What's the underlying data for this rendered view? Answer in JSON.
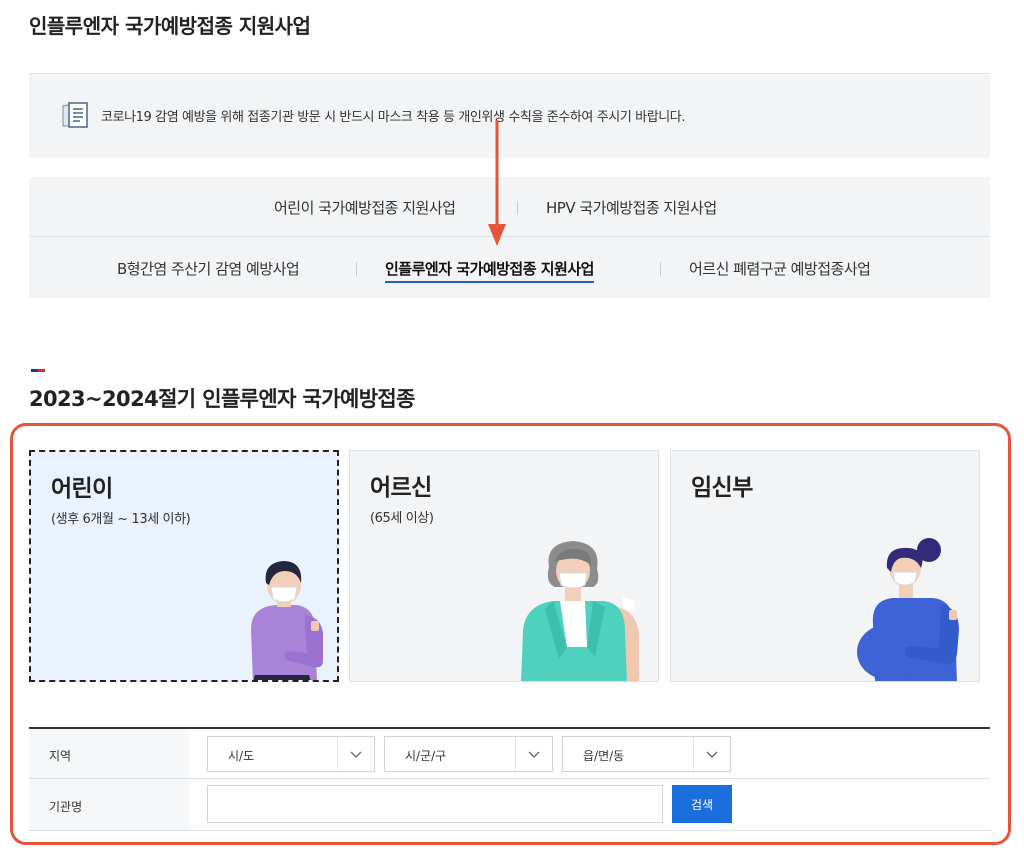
{
  "page_title": "인플루엔자 국가예방접종 지원사업",
  "notice": {
    "text": "코로나19 감염 예방을 위해 접종기관 방문 시 반드시 마스크 착용 등 개인위생 수칙을 준수하여 주시기 바랍니다."
  },
  "tabs": {
    "row1": [
      {
        "label": "어린이 국가예방접종 지원사업"
      },
      {
        "label": "HPV 국가예방접종 지원사업"
      }
    ],
    "row2": [
      {
        "label": "B형간염 주산기 감염 예방사업"
      },
      {
        "label": "인플루엔자 국가예방접종 지원사업",
        "active": true
      },
      {
        "label": "어르신 폐렴구균 예방접종사업"
      }
    ]
  },
  "section": {
    "title": "2023~2024절기 인플루엔자 국가예방접종"
  },
  "cards": [
    {
      "title": "어린이",
      "subtitle": "(생후 6개월 ~ 13세 이하)",
      "selected": true
    },
    {
      "title": "어르신",
      "subtitle": "(65세 이상)",
      "selected": false
    },
    {
      "title": "임신부",
      "subtitle": "",
      "selected": false
    }
  ],
  "form": {
    "region_label": "지역",
    "sido": "시/도",
    "sigungu": "시/군/구",
    "eupmyeondong": "읍/면/동",
    "institution_label": "기관명",
    "institution_value": "",
    "search_label": "검색"
  },
  "colors": {
    "accent": "#1b6fdc",
    "annotation": "#e5553a",
    "tab_underline": "#1a63c9"
  }
}
